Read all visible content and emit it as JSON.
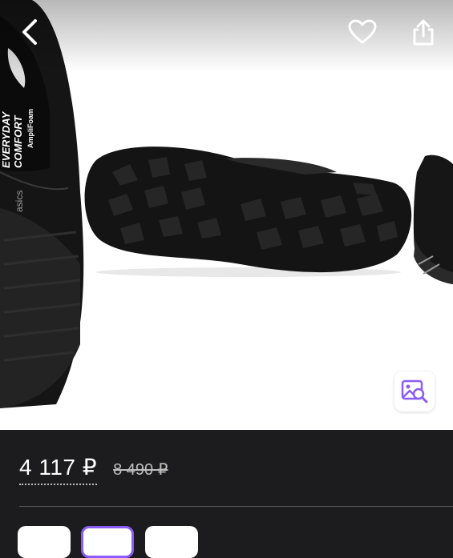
{
  "header": {
    "back_icon": "chevron-left-icon",
    "favorite_icon": "heart-icon",
    "share_icon": "share-icon"
  },
  "gallery": {
    "visual_search_icon": "image-search-icon",
    "accent_color": "#8b5cf6",
    "insole_text": {
      "line1": "EVERYDAY",
      "line2": "COMFORT",
      "line3": "AmpliFoam",
      "brand": "asics"
    }
  },
  "product": {
    "price": "4 117 ₽",
    "old_price": "8 490 ₽"
  },
  "variants": [
    {
      "selected": false
    },
    {
      "selected": true
    },
    {
      "selected": false
    }
  ]
}
